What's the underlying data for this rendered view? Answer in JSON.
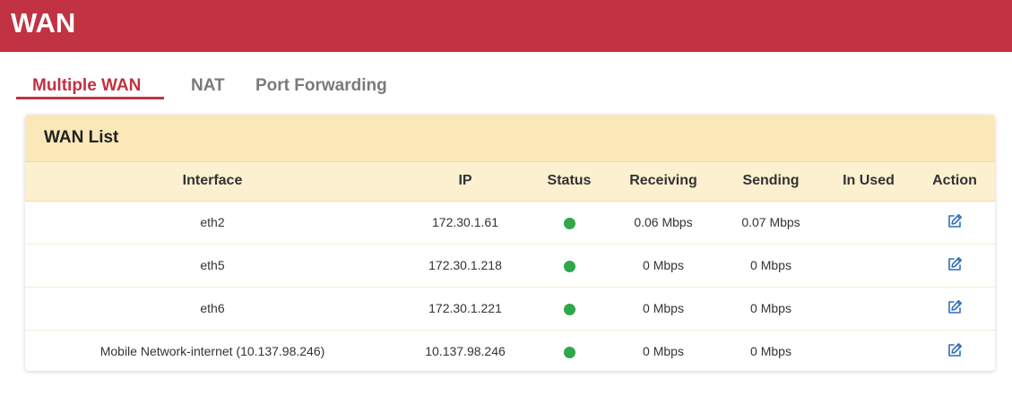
{
  "header": {
    "title": "WAN"
  },
  "tabs": [
    {
      "label": "Multiple WAN",
      "active": true
    },
    {
      "label": "NAT",
      "active": false
    },
    {
      "label": "Port Forwarding",
      "active": false
    }
  ],
  "wan_list": {
    "title": "WAN List",
    "columns": [
      "Interface",
      "IP",
      "Status",
      "Receiving",
      "Sending",
      "In Used",
      "Action"
    ],
    "rows": [
      {
        "interface": "eth2",
        "ip": "172.30.1.61",
        "status": "up",
        "receiving": "0.06 Mbps",
        "sending": "0.07 Mbps",
        "in_used": ""
      },
      {
        "interface": "eth5",
        "ip": "172.30.1.218",
        "status": "up",
        "receiving": "0 Mbps",
        "sending": "0 Mbps",
        "in_used": ""
      },
      {
        "interface": "eth6",
        "ip": "172.30.1.221",
        "status": "up",
        "receiving": "0 Mbps",
        "sending": "0 Mbps",
        "in_used": ""
      },
      {
        "interface": "Mobile Network-internet (10.137.98.246)",
        "ip": "10.137.98.246",
        "status": "up",
        "receiving": "0 Mbps",
        "sending": "0 Mbps",
        "in_used": ""
      }
    ],
    "action_icon": "edit-icon"
  },
  "colors": {
    "brand": "#c13242",
    "status_up": "#2ea84a",
    "edit_icon": "#2f6fb5",
    "card_header": "#fbe8b8"
  }
}
